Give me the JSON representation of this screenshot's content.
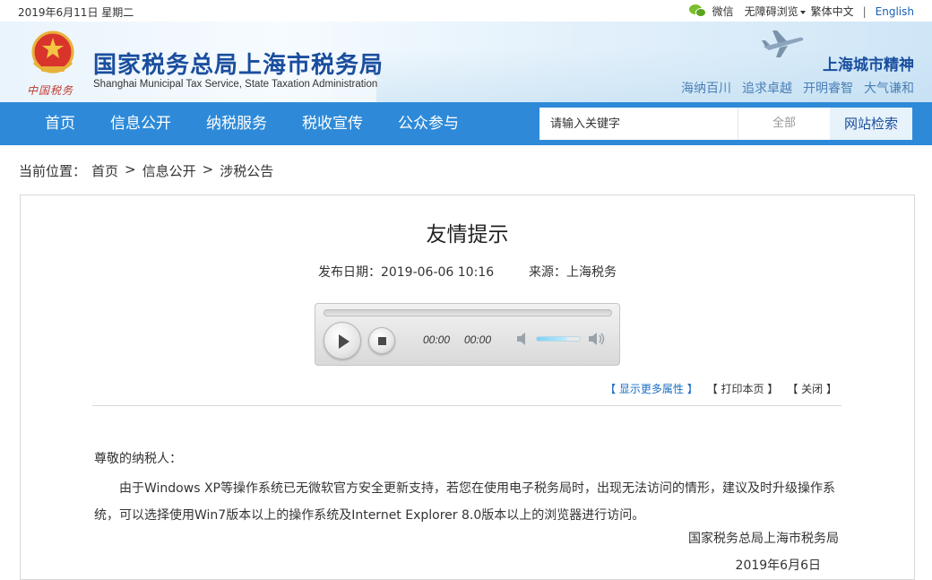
{
  "topbar": {
    "date": "2019年6月11日 星期二",
    "wechat": "微信",
    "accessibility": "无障碍浏览",
    "traditional": "繁体中文",
    "separator": "|",
    "english": "English"
  },
  "header": {
    "org_cn": "国家税务总局上海市税务局",
    "org_en": "Shanghai Municipal Tax Service, State Taxation Administration",
    "emblem_caption": "中国税务",
    "spirit_title": "上海城市精神",
    "spirit_words": [
      "海纳百川",
      "追求卓越",
      "开明睿智",
      "大气谦和"
    ]
  },
  "nav": {
    "items": [
      "首页",
      "信息公开",
      "纳税服务",
      "税收宣传",
      "公众参与"
    ],
    "search_placeholder": "请输入关键字",
    "search_scope": "全部",
    "search_button": "网站检索"
  },
  "breadcrumb": {
    "label": "当前位置：",
    "items": [
      "首页",
      "信息公开",
      "涉税公告"
    ],
    "sep": ">"
  },
  "article": {
    "title": "友情提示",
    "date_label": "发布日期：",
    "date": "2019-06-06 10:16",
    "source_label": "来源：",
    "source": "上海税务",
    "player": {
      "current_time": "00:00",
      "duration": "00:00",
      "volume": 0.7
    },
    "actions": {
      "more": "【 显示更多属性 】",
      "print": "【 打印本页 】",
      "close": "【 关闭 】"
    },
    "greeting": "尊敬的纳税人：",
    "paragraph": "由于Windows XP等操作系统已无微软官方安全更新支持，若您在使用电子税务局时，出现无法访问的情形，建议及时升级操作系统，可以选择使用Win7版本以上的操作系统及Internet Explorer 8.0版本以上的浏览器进行访问。",
    "signature": "国家税务总局上海市税务局",
    "sign_date": "2019年6月6日"
  },
  "colors": {
    "nav_bg": "#2e8ad8",
    "brand_blue": "#1a4e9e",
    "link_blue": "#1a6fc4"
  }
}
